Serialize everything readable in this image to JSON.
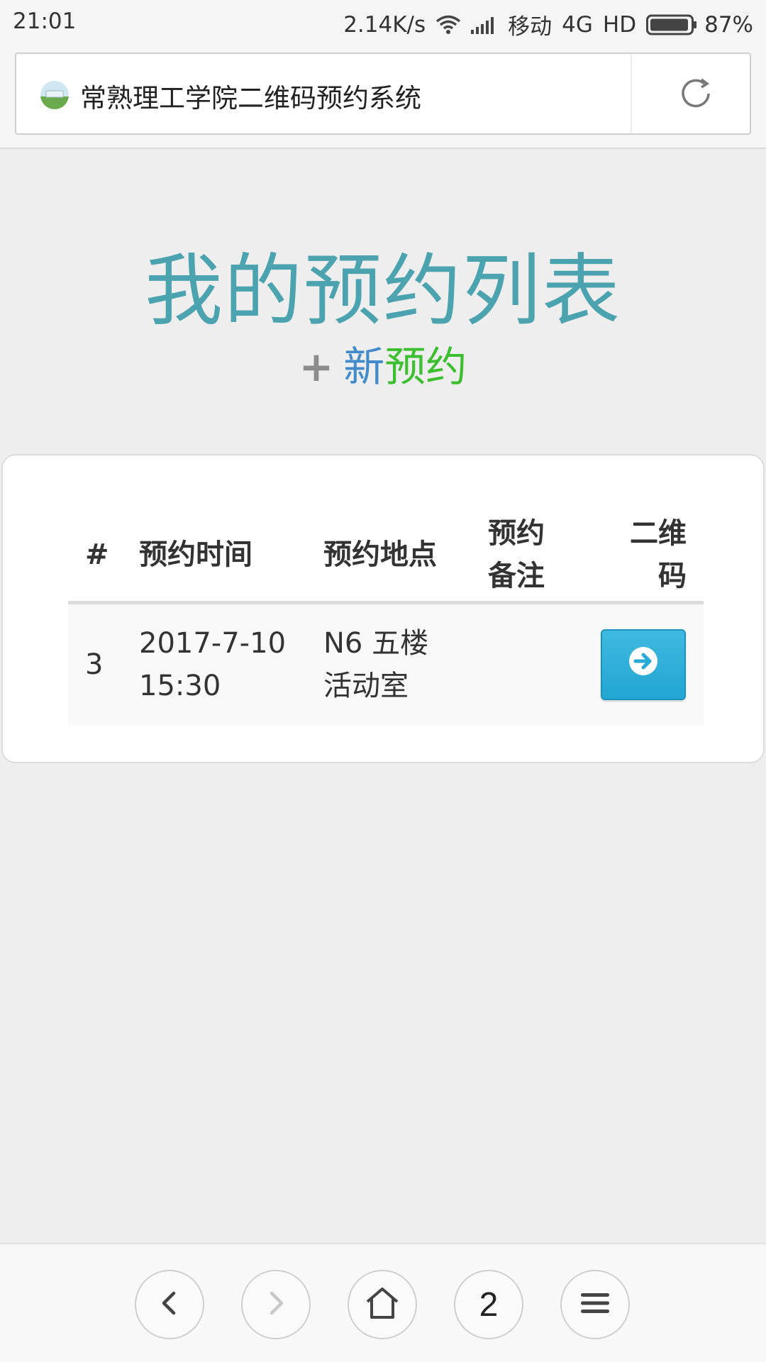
{
  "status_bar": {
    "time": "21:01",
    "speed": "2.14K/s",
    "carrier": "移动",
    "network": "4G",
    "hd": "HD",
    "battery": "87%"
  },
  "address_bar": {
    "title": "常熟理工学院二维码预约系统"
  },
  "header": {
    "title": "我的预约列表",
    "new_plus": "+",
    "new_part1": "新",
    "new_part2": "预约"
  },
  "table": {
    "headers": {
      "num": "#",
      "time": "预约时间",
      "location": "预约地点",
      "note_line1": "预约",
      "note_line2": "备注",
      "qr_line1": "二维",
      "qr_line2": "码"
    },
    "rows": [
      {
        "num": "3",
        "date": "2017-7-10",
        "clock": "15:30",
        "loc_line1": "N6 五楼",
        "loc_line2": "活动室",
        "note": ""
      }
    ]
  },
  "bottom_nav": {
    "tab_count": "2"
  },
  "colors": {
    "title": "#4aa3ae",
    "new_part1": "#428bca",
    "new_part2": "#3bbf2f",
    "qr_button": "#2fb0da"
  }
}
